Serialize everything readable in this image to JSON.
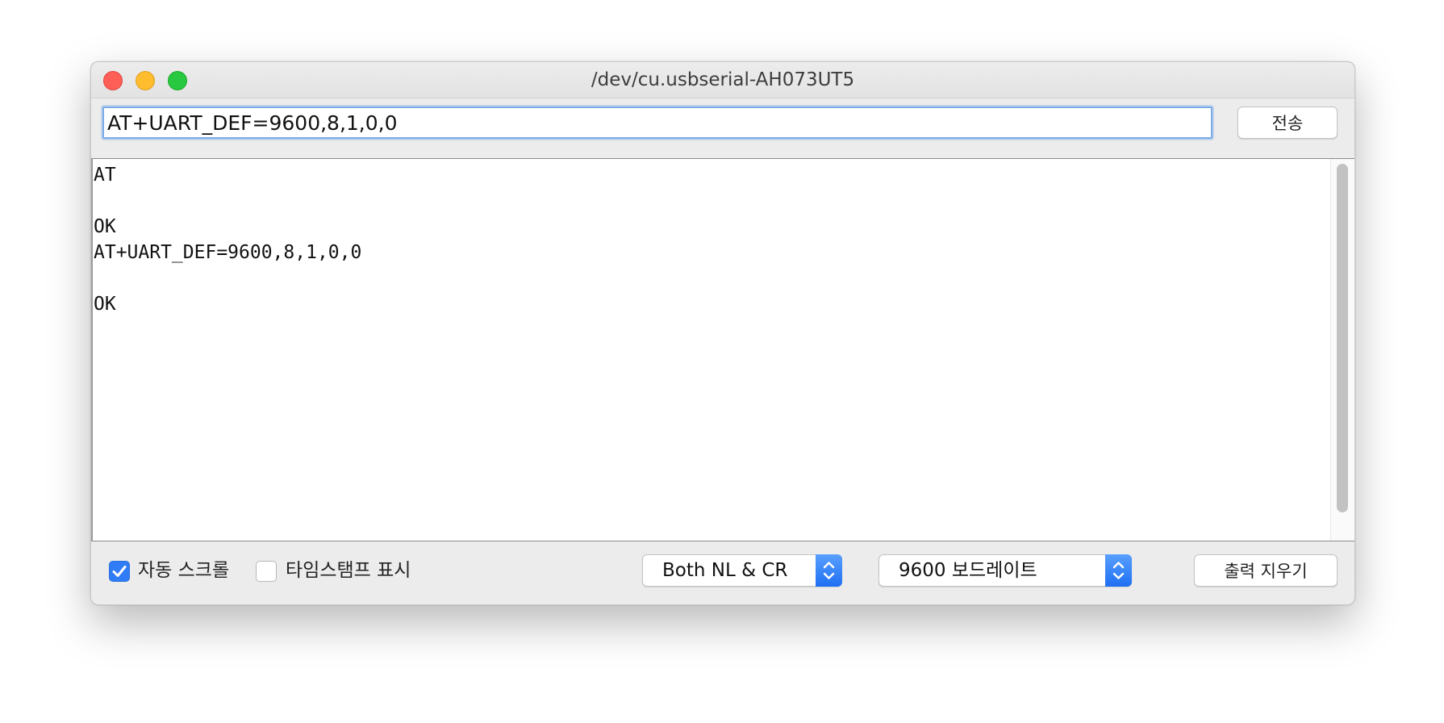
{
  "window": {
    "title": "/dev/cu.usbserial-AH073UT5"
  },
  "input": {
    "value": "AT+UART_DEF=9600,8,1,0,0"
  },
  "send_button": {
    "label": "전송"
  },
  "output": {
    "text": "AT\n\nOK\nAT+UART_DEF=9600,8,1,0,0\n\nOK"
  },
  "controls": {
    "autoscroll": {
      "label": "자동 스크롤",
      "checked": true
    },
    "timestamp": {
      "label": "타임스탬프 표시",
      "checked": false
    },
    "line_ending": {
      "selected": "Both NL & CR"
    },
    "baud_rate": {
      "selected": "9600 보드레이트"
    },
    "clear_button": {
      "label": "출력 지우기"
    }
  },
  "colors": {
    "accent": "#2f7cf6",
    "close": "#fe5f57",
    "minimize": "#febc2e",
    "maximize": "#28c840"
  },
  "icons": {
    "checkmark": "checkmark-icon",
    "select_arrows": "up-down-chevron-icon"
  }
}
